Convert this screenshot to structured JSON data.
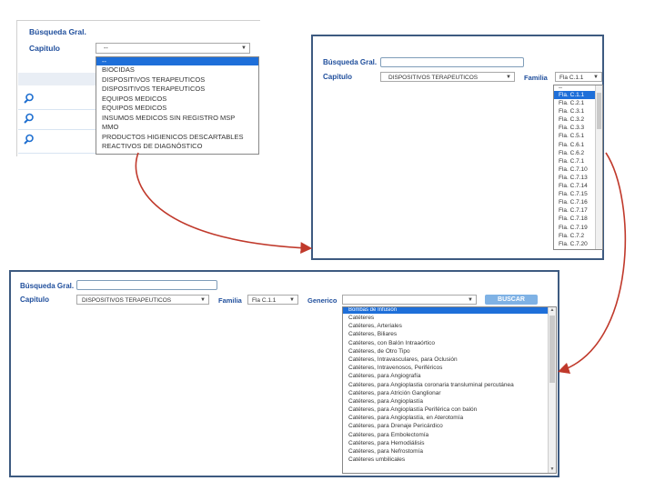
{
  "screen1": {
    "labels": {
      "busqueda": "Búsqueda Gral.",
      "capitulo": "Capitulo"
    },
    "capitulo_value": "--",
    "capitulo_options": [
      "--",
      "BIOCIDAS",
      "DISPOSITIVOS TERAPEUTICOS",
      "DISPOSITIVOS TERAPEUTICOS",
      "EQUIPOS MEDICOS",
      "EQUIPOS MEDICOS",
      "INSUMOS MEDICOS SIN REGISTRO MSP",
      "MMO",
      "PRODUCTOS HIGIENICOS DESCARTABLES",
      "REACTIVOS DE DIAGNÓSTICO"
    ]
  },
  "screen2": {
    "labels": {
      "busqueda": "Búsqueda Gral.",
      "capitulo": "Capitulo",
      "familia": "Familia"
    },
    "capitulo_value": "DISPOSITIVOS TERAPEUTICOS",
    "familia_value": "Fla C.1.1",
    "familia_options": [
      "--",
      "Fla. C.1.1",
      "Fla. C.2.1",
      "Fla. C.3.1",
      "Fla. C.3.2",
      "Fla. C.3.3",
      "Fla. C.5.1",
      "Fla. C.6.1",
      "Fla. C.6.2",
      "Fla. C.7.1",
      "Fla. C.7.10",
      "Fla. C.7.13",
      "Fla. C.7.14",
      "Fla. C.7.15",
      "Fla. C.7.16",
      "Fla. C.7.17",
      "Fla. C.7.18",
      "Fla. C.7.19",
      "Fla. C.7.2",
      "Fla. C.7.20"
    ],
    "familia_selected_index": 1
  },
  "screen3": {
    "labels": {
      "busqueda": "Búsqueda Gral.",
      "capitulo": "Capitulo",
      "familia": "Familia",
      "generico": "Generico"
    },
    "capitulo_value": "DISPOSITIVOS TERAPEUTICOS",
    "familia_value": "Fla C.1.1",
    "generico_value": "",
    "buscar_label": "BUSCAR",
    "generico_options": [
      "Bombas de Infusión",
      "Catéteres",
      "Catéteres, Arteriales",
      "Catéteres, Biliares",
      "Catéteres, con Balón Intraaórtico",
      "Catéteres, de Otro Tipo",
      "Catéteres, Intravasculares, para Oclusión",
      "Catéteres, Intravenosos, Periféricos",
      "Catéteres, para Angiografía",
      "Catéteres, para Angioplastia coronaria transluminal percutánea",
      "Catéteres, para Atrición Ganglionar",
      "Catéteres, para Angioplastía",
      "Catéteres, para Angioplastía Periférica con balón",
      "Catéteres, para Angioplastía, en Aterotomía",
      "Catéteres, para Drenaje Pericárdico",
      "Catéteres, para Embolectomía",
      "Catéteres, para Hemodiálisis",
      "Catéteres, para Nefrostomía",
      "Catéteres umbilicales"
    ],
    "generico_selected_index": 0
  }
}
